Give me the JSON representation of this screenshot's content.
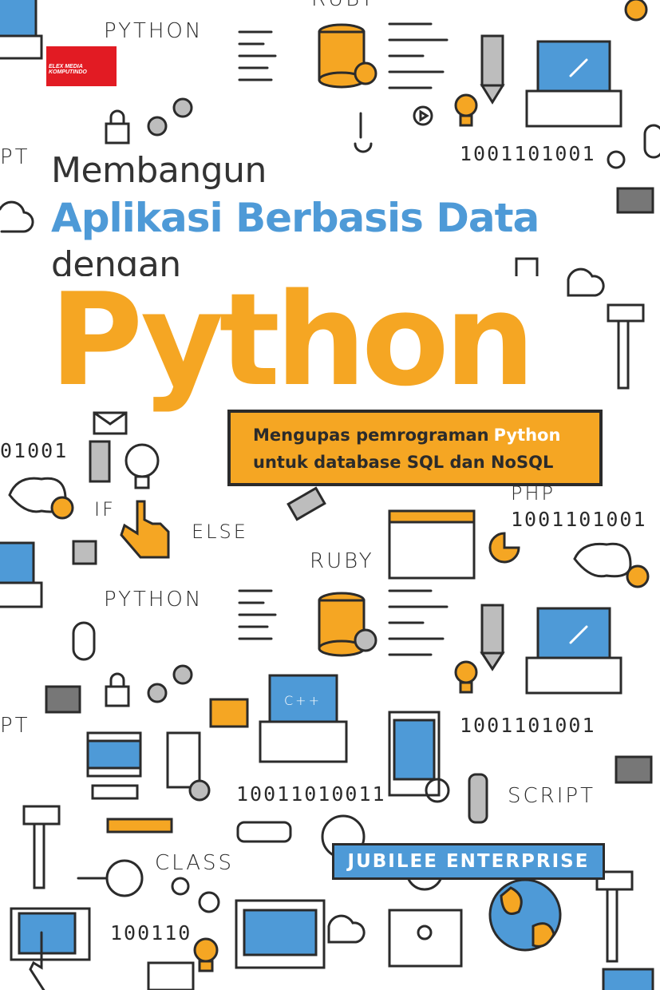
{
  "publisher": {
    "logo_text": "ELEX MEDIA KOMPUTINDO"
  },
  "title": {
    "line1": "Membangun",
    "line2": "Aplikasi Berbasis Data",
    "line3": "dengan",
    "line4": "Python"
  },
  "subtitle": {
    "line1_prefix": "Mengupas pemrograman",
    "line1_highlight": "Python",
    "line2": "untuk database SQL dan NoSQL"
  },
  "author": "JUBILEE ENTERPRISE",
  "doodle_words": {
    "python_top": "PYTHON",
    "script_left": "PT",
    "python_mid": "PYTHON",
    "script_left2": "PT",
    "else": "ELSE",
    "if": "IF",
    "ruby": "RUBY",
    "class": "CLASS",
    "script": "SCRIPT",
    "cpp": "C++",
    "php": "PHP",
    "ruby_top": "RUBY"
  },
  "binary": {
    "b1": "1001101001",
    "b2": "01001",
    "b3": "1001101001",
    "b4": "1001101001",
    "b5": "10011010011",
    "b6": "100110"
  },
  "colors": {
    "orange": "#f5a623",
    "blue": "#4e9ad7",
    "dark": "#2b2b2b",
    "red": "#e21b23"
  }
}
